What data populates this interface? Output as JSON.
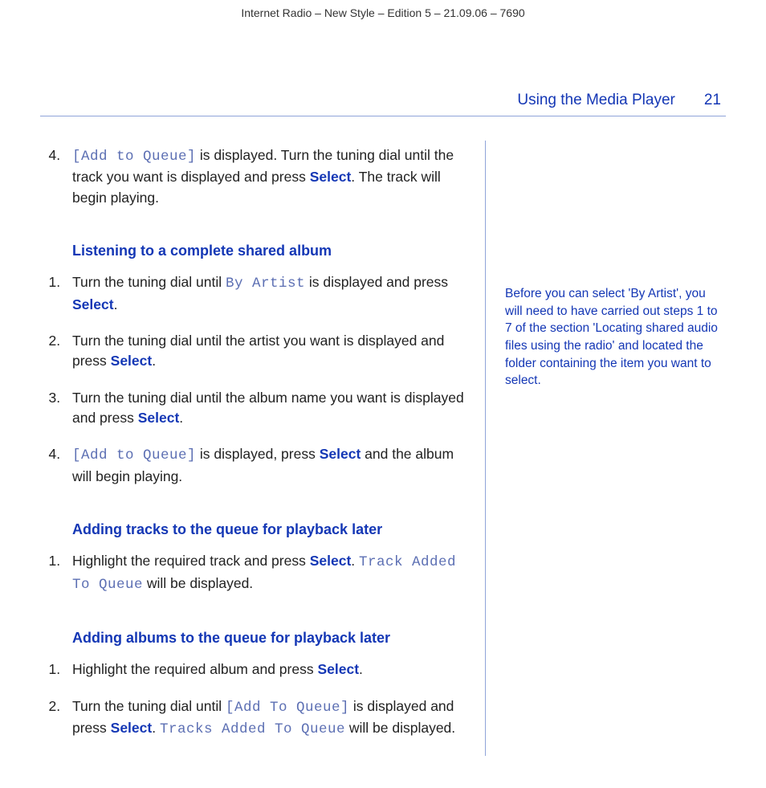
{
  "docHeader": "Internet Radio – New Style – Edition 5 – 21.09.06 – 7690",
  "sectionTitle": "Using the Media Player",
  "pageNum": "21",
  "intro": {
    "num": "4.",
    "lcd1": "[Add to Queue]",
    "t1": " is displayed. Turn the tuning dial until the track you want is displayed and press ",
    "select": "Select",
    "t2": ".  The track will begin playing."
  },
  "h1": "Listening to a complete shared album",
  "s1": {
    "a": "Turn the tuning dial until ",
    "lcd": "By Artist",
    "b": " is displayed and press ",
    "sel": "Select",
    "c": "."
  },
  "s2": {
    "a": "Turn the tuning dial until the artist you want is displayed and press ",
    "sel": "Select",
    "b": "."
  },
  "s3": {
    "a": "Turn the tuning dial until the album name you want is displayed and press ",
    "sel": "Select",
    "b": "."
  },
  "s4": {
    "lcd": "[Add to Queue]",
    "a": " is displayed, press ",
    "sel": "Select",
    "b": " and the album will begin playing."
  },
  "h2": "Adding tracks to the queue for playback later",
  "q1": {
    "a": "Highlight the required track and press ",
    "sel": "Select",
    "b": ". ",
    "lcd": "Track Added To Queue",
    "c": " will be displayed."
  },
  "h3": "Adding albums to the queue for playback later",
  "r1": {
    "a": "Highlight the required album and press ",
    "sel": "Select",
    "b": "."
  },
  "r2": {
    "a": "Turn the tuning dial until ",
    "lcd1": "[Add To Queue]",
    "b": " is displayed and press ",
    "sel": "Select",
    "c": ". ",
    "lcd2": "Tracks Added To Queue",
    "d": " will be displayed."
  },
  "sideNote": "Before you can select 'By Artist', you will need to have carried out steps 1 to 7 of the section 'Locating shared audio files using the radio' and located the folder containing the item you want to select."
}
